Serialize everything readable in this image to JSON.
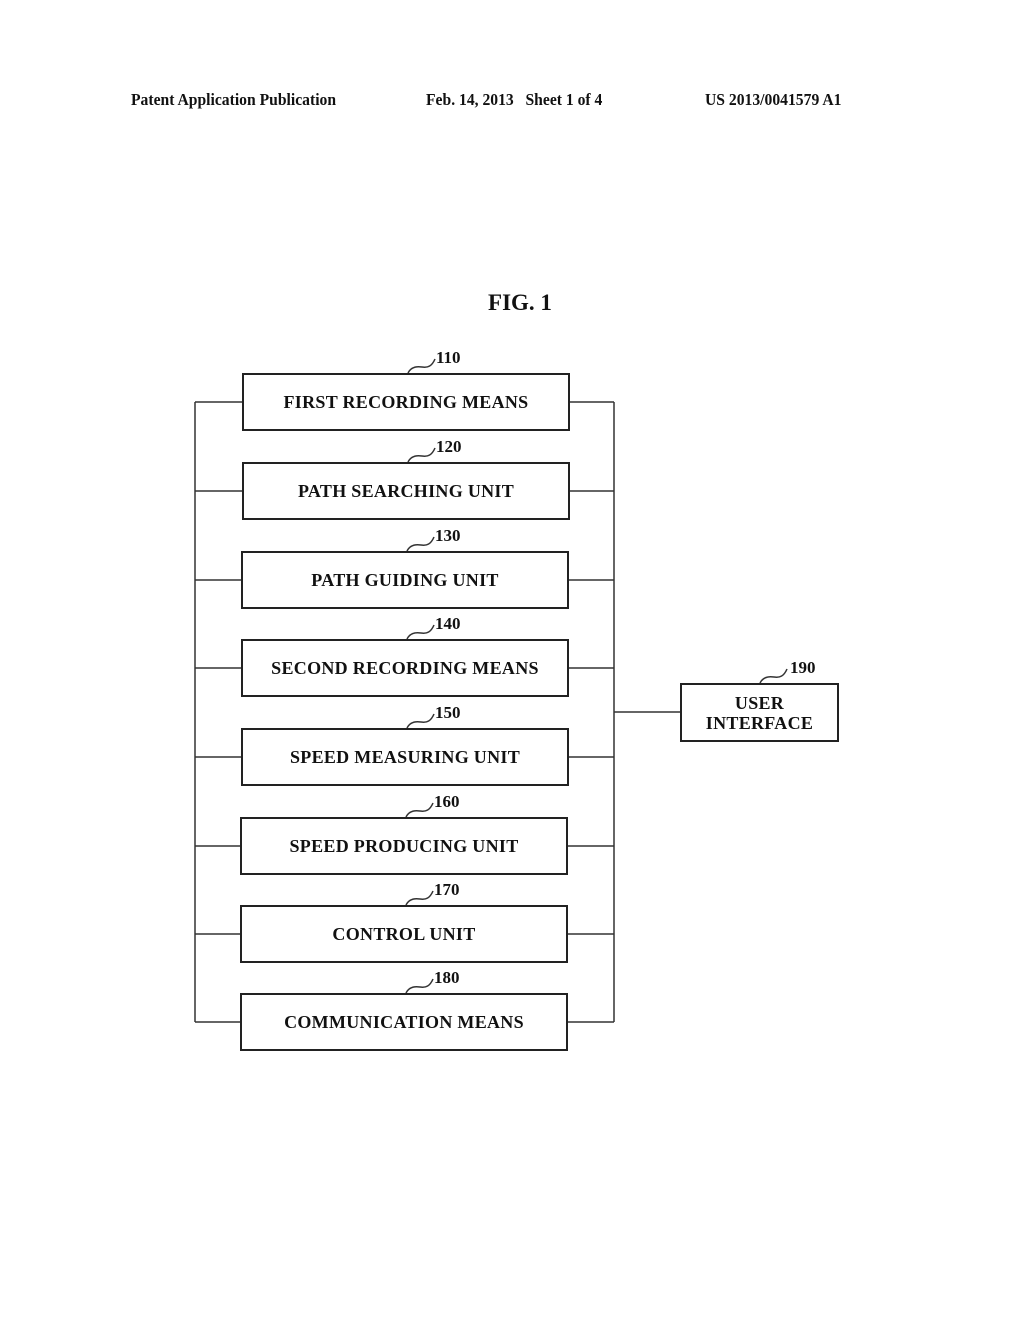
{
  "header": {
    "publication": "Patent Application Publication",
    "date_sheet": "Feb. 14, 2013   Sheet 1 of 4",
    "number": "US 2013/0041579 A1"
  },
  "figure": {
    "title": "FIG. 1",
    "blocks": [
      {
        "ref": "110",
        "label": "FIRST RECORDING MEANS"
      },
      {
        "ref": "120",
        "label": "PATH SEARCHING UNIT"
      },
      {
        "ref": "130",
        "label": "PATH GUIDING UNIT"
      },
      {
        "ref": "140",
        "label": "SECOND RECORDING MEANS"
      },
      {
        "ref": "150",
        "label": "SPEED MEASURING UNIT"
      },
      {
        "ref": "160",
        "label": "SPEED PRODUCING UNIT"
      },
      {
        "ref": "170",
        "label": "CONTROL UNIT"
      },
      {
        "ref": "180",
        "label": "COMMUNICATION MEANS"
      }
    ],
    "user_interface": {
      "ref": "190",
      "label_line1": "USER",
      "label_line2": "INTERFACE"
    }
  }
}
